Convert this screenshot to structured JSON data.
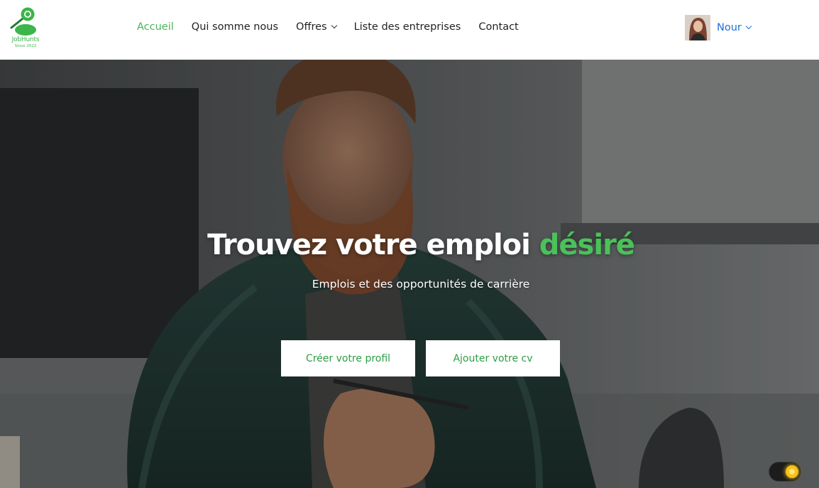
{
  "brand": {
    "name": "JobHunts",
    "tagline": "Since 2022",
    "color": "#3cb54a"
  },
  "nav": {
    "items": [
      {
        "label": "Accueil",
        "active": true
      },
      {
        "label": "Qui somme nous",
        "active": false
      },
      {
        "label": "Offres",
        "active": false,
        "dropdown": true
      },
      {
        "label": "Liste des entreprises",
        "active": false
      },
      {
        "label": "Contact",
        "active": false
      }
    ]
  },
  "user": {
    "name": "Nour",
    "color": "#1e6fd9"
  },
  "hero": {
    "title_main": "Trouvez votre emploi ",
    "title_accent": "désiré",
    "subtitle": "Emplois et des opportunités de carrière",
    "accent_color": "#49c25a"
  },
  "buttons": {
    "profile": "Créer votre profil",
    "cv": "Ajouter votre cv"
  },
  "theme_toggle": {
    "icon": "sun-icon",
    "state": "light"
  }
}
